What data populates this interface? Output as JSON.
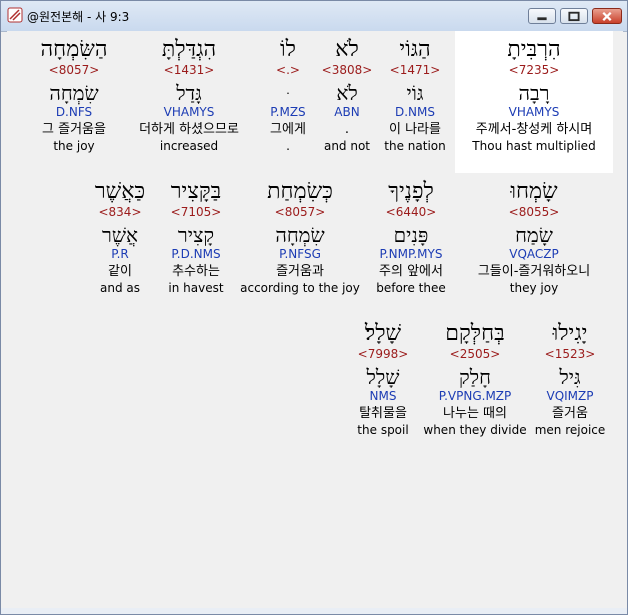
{
  "window": {
    "title": "@원전본해 - 사 9:3"
  },
  "rows": [
    [
      {
        "heb": "הִרְבִּיתָ",
        "strong": "<7235>",
        "lemma": "רָבָה",
        "morph": "VHAMYS",
        "kor": "주께서-창성케 하시며",
        "eng": "Thou hast multiplied"
      },
      {
        "heb": "הַגּוֹי",
        "strong": "<1471>",
        "lemma": "גּוֹי",
        "morph": "D.NMS",
        "kor": "이 나라를",
        "eng": "the nation"
      },
      {
        "heb": "לֹא",
        "strong": "<3808>",
        "lemma": "לֹא",
        "morph": "ABN",
        "kor": ".",
        "eng": "and not"
      },
      {
        "heb": "לוֹ",
        "strong": "<.>",
        "lemma": "ּ",
        "morph": "P.MZS",
        "kor": "그에게",
        "eng": "."
      },
      {
        "heb": "הִגְדַּלְתָּ",
        "strong": "<1431>",
        "lemma": "גָּדַל",
        "morph": "VHAMYS",
        "kor": "더하게 하셨으므로",
        "eng": "increased"
      },
      {
        "heb": "הַשִּׂמְחָה",
        "strong": "<8057>",
        "lemma": "שִׂמְחָה",
        "morph": "D.NFS",
        "kor": "그 즐거움을",
        "eng": "the joy"
      }
    ],
    [
      {
        "heb": "שָׂמְחוּ",
        "strong": "<8055>",
        "lemma": "שָׂמַח",
        "morph": "VQACZP",
        "kor": "그들이-즐거워하오니",
        "eng": "they joy"
      },
      {
        "heb": "לְפָנֶיךָ",
        "strong": "<6440>",
        "lemma": "פָּנִים",
        "morph": "P.NMP.MYS",
        "kor": "주의 앞에서",
        "eng": "before thee"
      },
      {
        "heb": "כְּשִׂמְחַת",
        "strong": "<8057>",
        "lemma": "שִׂמְחָה",
        "morph": "P.NFSG",
        "kor": "즐거움과",
        "eng": "according to the joy"
      },
      {
        "heb": "בַּקָּצִיר",
        "strong": "<7105>",
        "lemma": "קָצִיר",
        "morph": "P.D.NMS",
        "kor": "추수하는",
        "eng": "in havest"
      },
      {
        "heb": "כַּאֲשֶׁר",
        "strong": "<834>",
        "lemma": "אֲשֶׁר",
        "morph": "P.R",
        "kor": "같이",
        "eng": "and as"
      }
    ],
    [
      {
        "heb": "יָגִילוּ",
        "strong": "<1523>",
        "lemma": "גִּיל",
        "morph": "VQIMZP",
        "kor": "즐거움",
        "eng": "men rejoice"
      },
      {
        "heb": "בְּחַלְּקָם",
        "strong": "<2505>",
        "lemma": "חָלַק",
        "morph": "P.VPNG.MZP",
        "kor": "나누는 때의",
        "eng": "when they divide"
      },
      {
        "heb": "שָׁלָל׃",
        "strong": "<7998>",
        "lemma": "שָׁלָל",
        "morph": "NMS",
        "kor": "탈취물을",
        "eng": "the spoil"
      }
    ]
  ]
}
